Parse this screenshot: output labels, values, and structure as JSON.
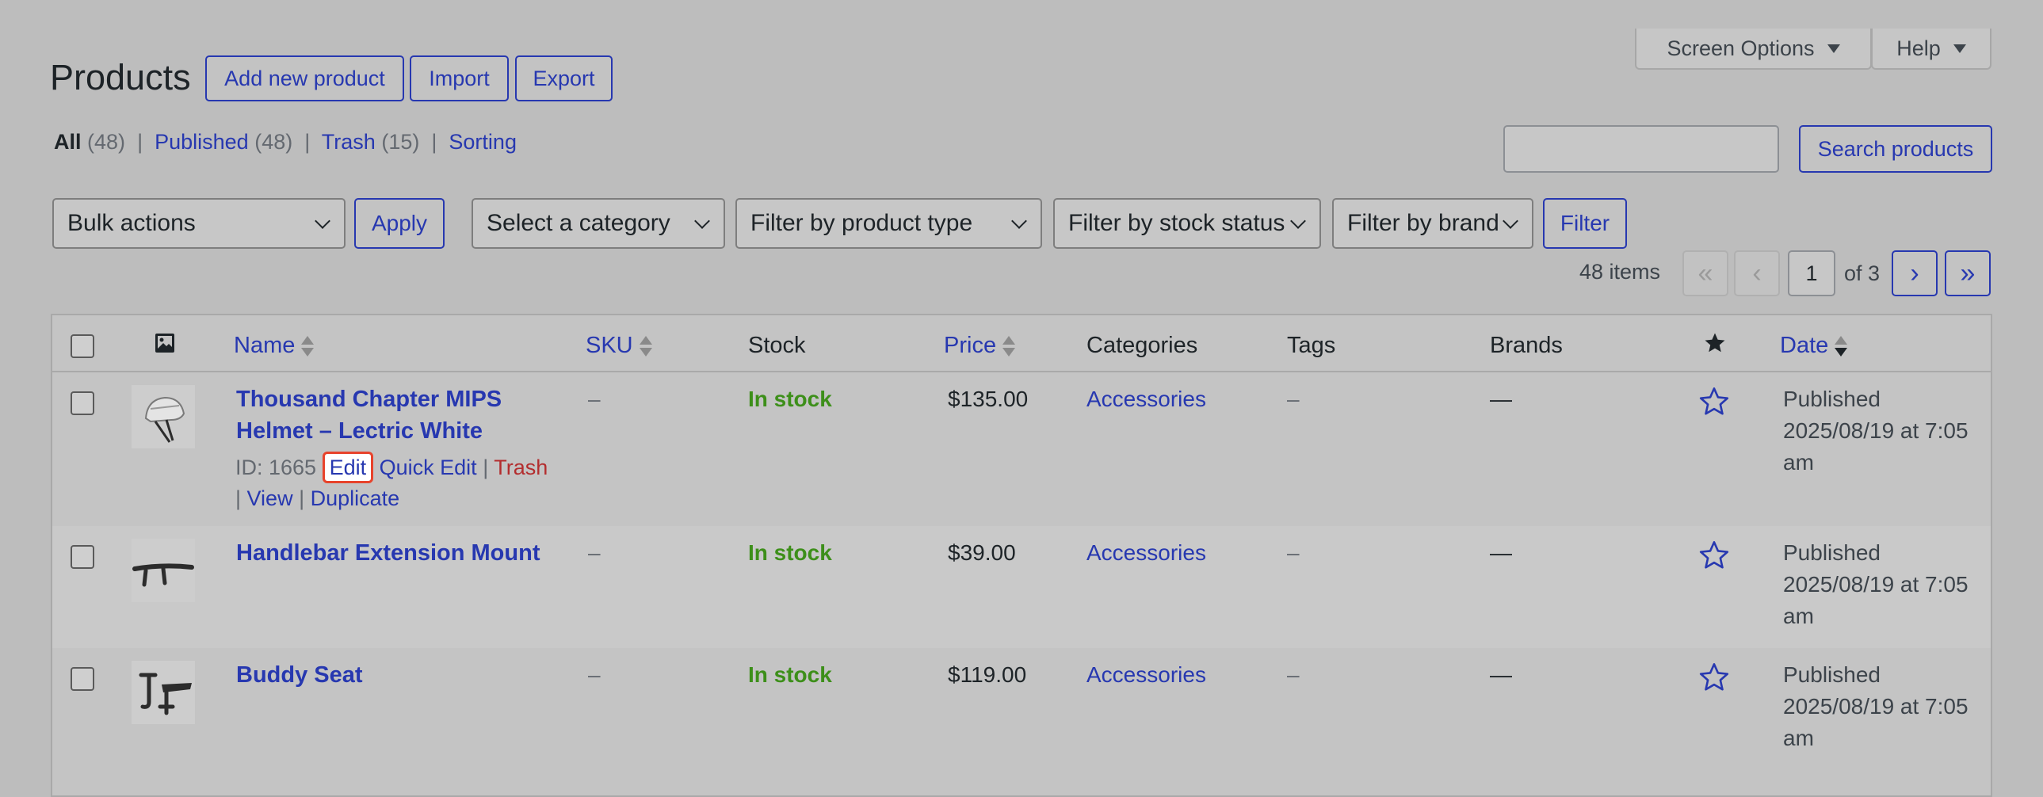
{
  "header": {
    "title": "Products",
    "add_new": "Add new product",
    "import": "Import",
    "export": "Export",
    "screen_options": "Screen Options",
    "help": "Help"
  },
  "views": [
    {
      "label": "All",
      "count": "(48)"
    },
    {
      "label": "Published",
      "count": "(48)"
    },
    {
      "label": "Trash",
      "count": "(15)"
    },
    {
      "label": "Sorting",
      "count": ""
    }
  ],
  "search": {
    "value": "",
    "button": "Search products"
  },
  "filters": {
    "bulk_actions": "Bulk actions",
    "apply": "Apply",
    "category": "Select a category",
    "product_type": "Filter by product type",
    "stock_status": "Filter by stock status",
    "brand": "Filter by brand",
    "filter": "Filter"
  },
  "pagination": {
    "items": "48 items",
    "first": "«",
    "prev": "‹",
    "current": "1",
    "of": "of 3",
    "next": "›",
    "last": "»"
  },
  "columns": {
    "name": "Name",
    "sku": "SKU",
    "stock": "Stock",
    "price": "Price",
    "categories": "Categories",
    "tags": "Tags",
    "brands": "Brands",
    "date": "Date"
  },
  "icons": {
    "image_column": "image-icon",
    "featured_column": "star-icon"
  },
  "products": [
    {
      "name_line1": "Thousand Chapter MIPS",
      "name_line2": "Helmet – Lectric White",
      "sku": "–",
      "stock": "In stock",
      "price": "$135.00",
      "category": "Accessories",
      "tags": "–",
      "brands": "—",
      "date_status": "Published",
      "date_value": "2025/08/19 at 7:05",
      "date_suffix": "am",
      "row_actions": {
        "id": "ID: 1665",
        "edit": "Edit",
        "quick_edit": "Quick Edit",
        "trash": "Trash",
        "view": "View",
        "duplicate": "Duplicate"
      }
    },
    {
      "name_line1": "Handlebar Extension Mount",
      "sku": "–",
      "stock": "In stock",
      "price": "$39.00",
      "category": "Accessories",
      "tags": "–",
      "brands": "—",
      "date_status": "Published",
      "date_value": "2025/08/19 at 7:05",
      "date_suffix": "am"
    },
    {
      "name_line1": "Buddy Seat",
      "sku": "–",
      "stock": "In stock",
      "price": "$119.00",
      "category": "Accessories",
      "tags": "–",
      "brands": "—",
      "date_status": "Published",
      "date_value": "2025/08/19 at 7:05",
      "date_suffix": "am"
    }
  ],
  "colors": {
    "link": "#2738b0",
    "in_stock": "#3d8f1a",
    "trash": "#b32d2e",
    "highlight": "#e8432b",
    "background": "#bdbdbd"
  }
}
